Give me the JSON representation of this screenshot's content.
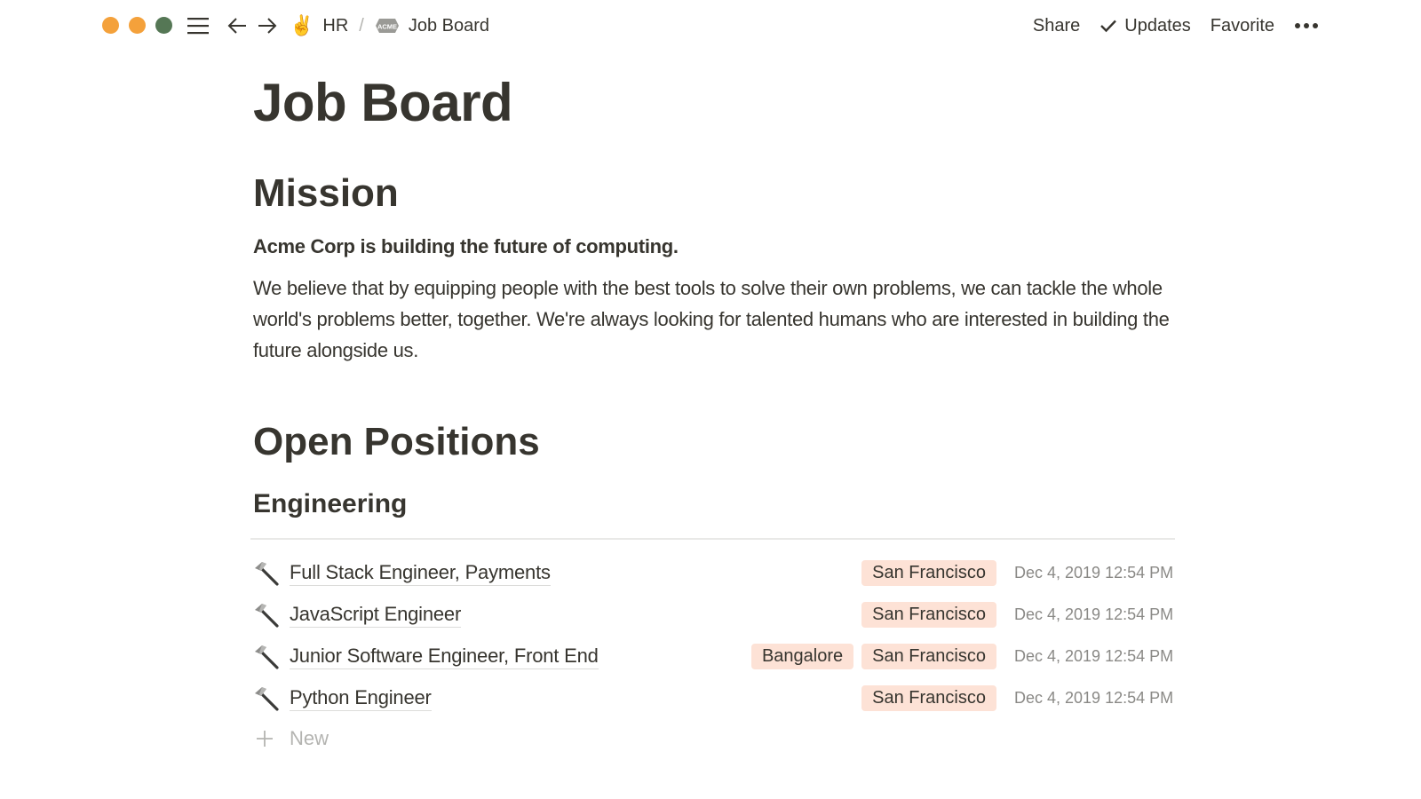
{
  "window": {
    "traffic_lights": [
      {
        "name": "close",
        "color": "#f4a13b"
      },
      {
        "name": "minimize",
        "color": "#f4a13b"
      },
      {
        "name": "maximize",
        "color": "#557755"
      }
    ]
  },
  "topbar": {
    "breadcrumb": [
      {
        "icon": "victory-hand-emoji",
        "glyph": "✌️",
        "label": "HR"
      },
      {
        "icon": "acme-logo-icon",
        "label": "Job Board"
      }
    ],
    "separator": "/",
    "acme_logo_text": "ACME",
    "actions": {
      "share": "Share",
      "updates": "Updates",
      "favorite": "Favorite"
    }
  },
  "page": {
    "title": "Job Board",
    "mission": {
      "heading": "Mission",
      "lead": "Acme Corp is building the future of computing.",
      "body": "We believe that by equipping people with the best tools to solve their own problems, we can tackle the whole world's problems better, together. We're always looking for talented humans who are interested in building the future alongside us."
    },
    "open_positions": {
      "heading": "Open Positions",
      "group": "Engineering",
      "rows": [
        {
          "icon": "hammer-icon",
          "title": "Full Stack Engineer, Payments",
          "tags": [
            "San Francisco"
          ],
          "date": "Dec 4, 2019 12:54 PM"
        },
        {
          "icon": "hammer-icon",
          "title": "JavaScript Engineer",
          "tags": [
            "San Francisco"
          ],
          "date": "Dec 4, 2019 12:54 PM"
        },
        {
          "icon": "hammer-icon",
          "title": "Junior Software Engineer, Front End",
          "tags": [
            "Bangalore",
            "San Francisco"
          ],
          "date": "Dec 4, 2019 12:54 PM"
        },
        {
          "icon": "hammer-icon",
          "title": "Python Engineer",
          "tags": [
            "San Francisco"
          ],
          "date": "Dec 4, 2019 12:54 PM"
        }
      ],
      "new_label": "New"
    }
  },
  "colors": {
    "text": "#37352f",
    "tag_bg": "#fde2d6",
    "muted": "#8a8986",
    "divider": "#e9e9e7"
  }
}
